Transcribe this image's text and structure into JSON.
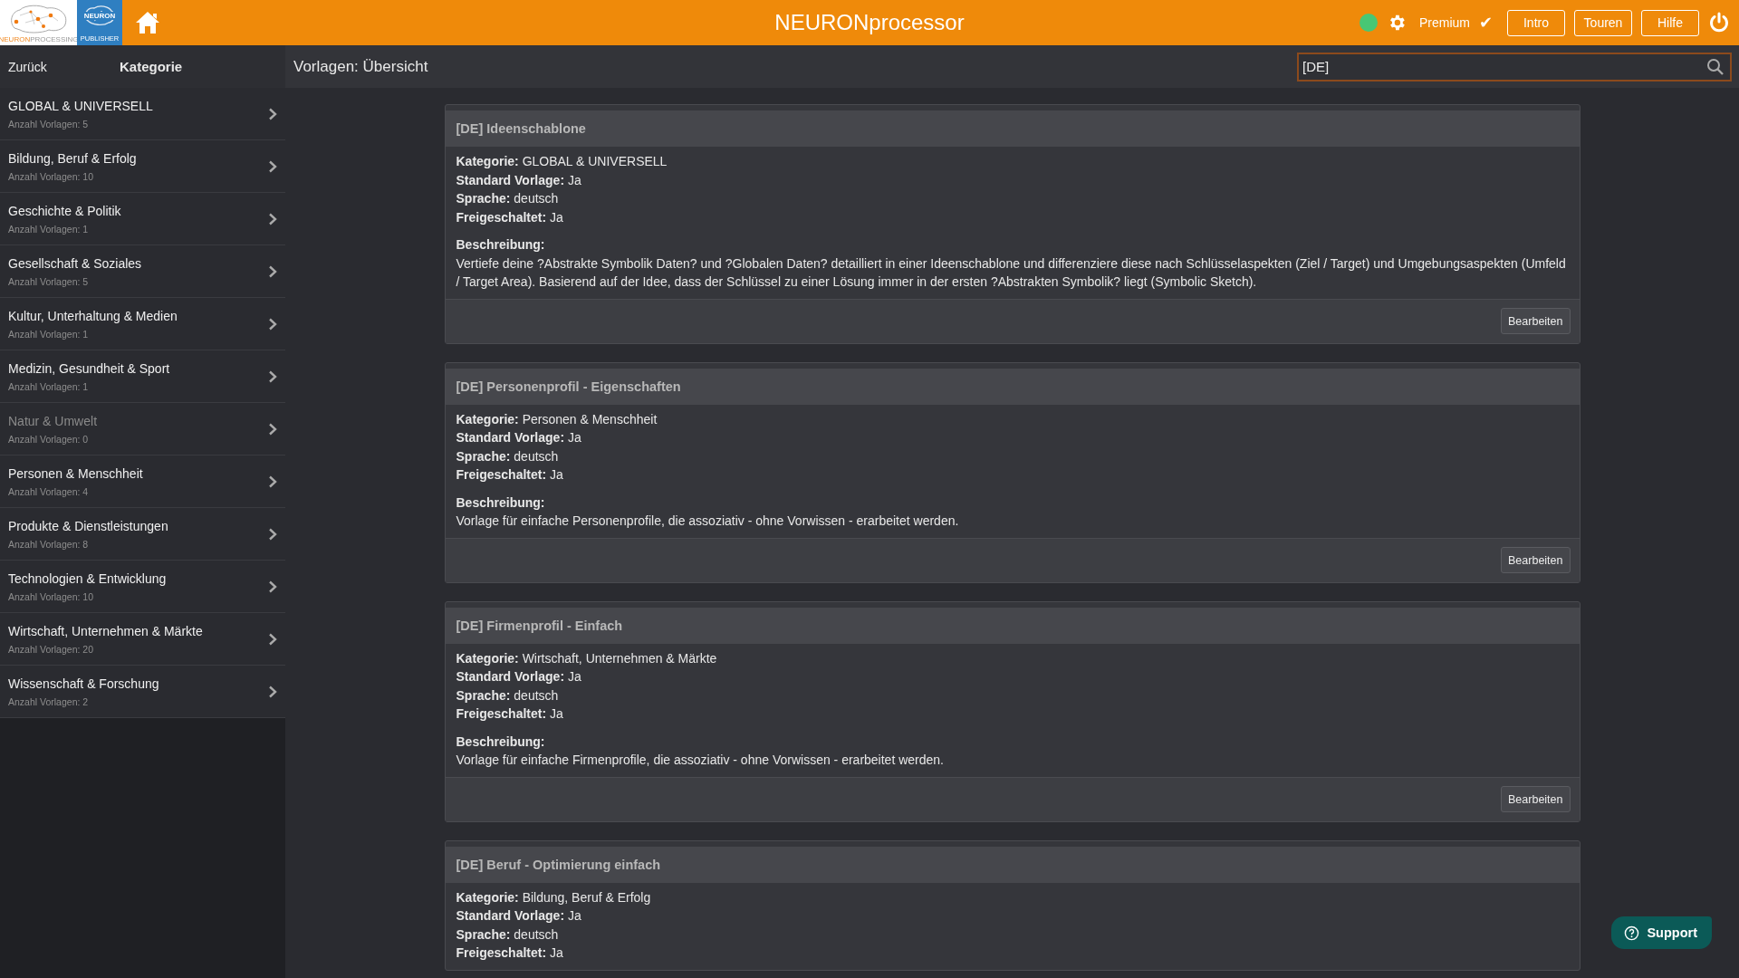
{
  "header": {
    "logo": {
      "part1": "NEURON",
      "part2": "PROCESSING"
    },
    "publisher_logo": {
      "brand": "NEURON",
      "caption": "PUBLISHER"
    },
    "title": "NEURONprocessor",
    "status": {
      "color": "#48c774"
    },
    "premium": {
      "label": "Premium",
      "mark": "✔"
    },
    "buttons": [
      "Intro",
      "Touren",
      "Hilfe"
    ]
  },
  "subheader": {
    "back": "Zurück",
    "category_heading": "Kategorie",
    "page_title": "Vorlagen: Übersicht",
    "search": {
      "value": "[DE]"
    }
  },
  "categories": [
    {
      "name": "GLOBAL & UNIVERSELL",
      "count": "Anzahl Vorlagen: 5",
      "disabled": false
    },
    {
      "name": "Bildung, Beruf & Erfolg",
      "count": "Anzahl Vorlagen: 10",
      "disabled": false
    },
    {
      "name": "Geschichte & Politik",
      "count": "Anzahl Vorlagen: 1",
      "disabled": false
    },
    {
      "name": "Gesellschaft & Soziales",
      "count": "Anzahl Vorlagen: 5",
      "disabled": false
    },
    {
      "name": "Kultur, Unterhaltung & Medien",
      "count": "Anzahl Vorlagen: 1",
      "disabled": false
    },
    {
      "name": "Medizin, Gesundheit & Sport",
      "count": "Anzahl Vorlagen: 1",
      "disabled": false
    },
    {
      "name": "Natur & Umwelt",
      "count": "Anzahl Vorlagen: 0",
      "disabled": true
    },
    {
      "name": "Personen & Menschheit",
      "count": "Anzahl Vorlagen: 4",
      "disabled": false
    },
    {
      "name": "Produkte & Dienstleistungen",
      "count": "Anzahl Vorlagen: 8",
      "disabled": false
    },
    {
      "name": "Technologien & Entwicklung",
      "count": "Anzahl Vorlagen: 10",
      "disabled": false
    },
    {
      "name": "Wirtschaft, Unternehmen & Märkte",
      "count": "Anzahl Vorlagen: 20",
      "disabled": false
    },
    {
      "name": "Wissenschaft & Forschung",
      "count": "Anzahl Vorlagen: 2",
      "disabled": false
    }
  ],
  "templates": [
    {
      "title": "[DE] Ideenschablone",
      "fields": [
        {
          "label": "Kategorie:",
          "value": "GLOBAL & UNIVERSELL"
        },
        {
          "label": "Standard Vorlage:",
          "value": "Ja"
        },
        {
          "label": "Sprache:",
          "value": "deutsch"
        },
        {
          "label": "Freigeschaltet:",
          "value": "Ja"
        }
      ],
      "description_label": "Beschreibung:",
      "description": "Vertiefe deine ?Abstrakte Symbolik Daten? und ?Globalen Daten? detailliert in einer Ideenschablone und differenziere diese nach Schlüsselaspekten (Ziel / Target) und Umgebungsaspekten (Umfeld / Target Area). Basierend auf der Idee, dass der Schlüssel zu einer Lösung immer in der ersten ?Abstrakten Symbolik? liegt (Symbolic Sketch).",
      "button": "Bearbeiten"
    },
    {
      "title": "[DE] Personenprofil - Eigenschaften",
      "fields": [
        {
          "label": "Kategorie:",
          "value": "Personen & Menschheit"
        },
        {
          "label": "Standard Vorlage:",
          "value": "Ja"
        },
        {
          "label": "Sprache:",
          "value": "deutsch"
        },
        {
          "label": "Freigeschaltet:",
          "value": "Ja"
        }
      ],
      "description_label": "Beschreibung:",
      "description": "Vorlage für einfache Personenprofile, die assoziativ - ohne Vorwissen - erarbeitet werden.",
      "button": "Bearbeiten"
    },
    {
      "title": "[DE] Firmenprofil - Einfach",
      "fields": [
        {
          "label": "Kategorie:",
          "value": "Wirtschaft, Unternehmen & Märkte"
        },
        {
          "label": "Standard Vorlage:",
          "value": "Ja"
        },
        {
          "label": "Sprache:",
          "value": "deutsch"
        },
        {
          "label": "Freigeschaltet:",
          "value": "Ja"
        }
      ],
      "description_label": "Beschreibung:",
      "description": "Vorlage für einfache Firmenprofile, die assoziativ - ohne Vorwissen - erarbeitet werden.",
      "button": "Bearbeiten"
    },
    {
      "title": "[DE] Beruf - Optimierung einfach",
      "fields": [
        {
          "label": "Kategorie:",
          "value": "Bildung, Beruf & Erfolg"
        },
        {
          "label": "Standard Vorlage:",
          "value": "Ja"
        },
        {
          "label": "Sprache:",
          "value": "deutsch"
        },
        {
          "label": "Freigeschaltet:",
          "value": "Ja"
        }
      ]
    }
  ],
  "support": {
    "label": "Support"
  }
}
